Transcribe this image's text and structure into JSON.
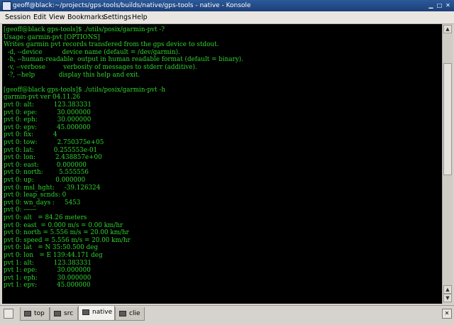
{
  "window": {
    "title": "geoff@black:~/projects/gps-tools/builds/native/gps-tools - native - Konsole"
  },
  "menu": [
    "Session",
    "Edit",
    "View",
    "Bookmarks",
    "Settings",
    "Help"
  ],
  "terminal": {
    "lines": [
      "[geoff@black gps-tools]$ ./utils/posix/garmin-pvt -?",
      "Usage: garmin-pvt [OPTIONS]",
      "Writes garmin pvt records transfered from the gps device to stdout.",
      "  -d, --device          device name (default = /dev/garmin).",
      "  -h, --human-readable  output in human readable format (default = binary).",
      "  -v, --verbose         verbosity of messages to stderr (additive).",
      "  -?, --help            display this help and exit.",
      "",
      "[geoff@black gps-tools]$ ./utils/posix/garmin-pvt -h",
      "garmin-pvt ver 04.11.26",
      "pvt 0: alt:          123.383331",
      "pvt 0: epe:          30.000000",
      "pvt 0: eph:          30.000000",
      "pvt 0: epv:          45.000000",
      "pvt 0: fix:          4",
      "pvt 0: tow:          2.750375e+05",
      "pvt 0: lat:          0.255553e-01",
      "pvt 0: lon:          2.438857e+00",
      "pvt 0: east:         0.000000",
      "pvt 0: north:        5.555556",
      "pvt 0: up:           0.000000",
      "pvt 0: msl_hght:     -39.126324",
      "pvt 0: leap_scnds: 0",
      "pvt 0: wn_days :     5453",
      "pvt 0: ------",
      "pvt 0: alt   = 84.26 meters",
      "pvt 0: east  = 0.000 m/s = 0.00 km/hr",
      "pvt 0: north = 5.556 m/s = 20.00 km/hr",
      "pvt 0: speed = 5.556 m/s = 20.00 km/hr",
      "pvt 0: lat   = N 35:50.500 deg",
      "pvt 0: lon   = E 139:44.171 deg",
      "pvt 1: alt:          123.383331",
      "pvt 1: epe:          30.000000",
      "pvt 1: eph:          30.000000",
      "pvt 1: epv:          45.000000",
      ""
    ]
  },
  "tabs": [
    {
      "label": "top",
      "active": false
    },
    {
      "label": "src",
      "active": false
    },
    {
      "label": "native",
      "active": true
    },
    {
      "label": "clie",
      "active": false
    }
  ],
  "icons": {
    "app": "konsole-icon",
    "minimize": "minimize-icon",
    "maximize": "maximize-icon",
    "close": "close-icon",
    "new_tab": "new-session-icon",
    "close_tab": "close-session-icon"
  },
  "colors": {
    "terminal_bg": "#000000",
    "terminal_fg": "#2fd32f",
    "titlebar": "#1c3f78"
  }
}
